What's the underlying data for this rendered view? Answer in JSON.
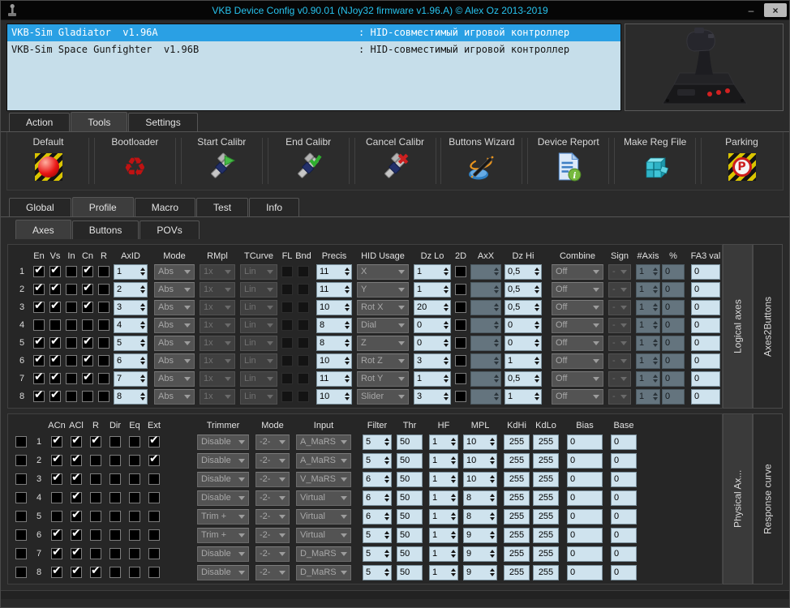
{
  "window": {
    "title": "VKB Device Config v0.90.01 (NJoy32 firmware v1.96.A) © Alex Oz 2013-2019",
    "minimize_label": "–",
    "close_label": "×"
  },
  "device_list": [
    {
      "name": "VKB-Sim Gladiator  v1.96A",
      "desc": ": HID-совместимый игровой контроллер",
      "selected": true
    },
    {
      "name": "VKB-Sim Space Gunfighter  v1.96B",
      "desc": ": HID-совместимый игровой контроллер",
      "selected": false
    }
  ],
  "joystick_image": "gladiator-joystick-photo",
  "main_tabs": [
    {
      "label": "Action",
      "active": false
    },
    {
      "label": "Tools",
      "active": true
    },
    {
      "label": "Settings",
      "active": false
    }
  ],
  "toolbar": [
    {
      "label": "Default",
      "icon": "default-hazard-icon"
    },
    {
      "label": "Bootloader",
      "icon": "bootloader-recycle-icon"
    },
    {
      "label": "Start Calibr",
      "icon": "caliper-play-icon"
    },
    {
      "label": "End Calibr",
      "icon": "caliper-check-icon"
    },
    {
      "label": "Cancel Calibr",
      "icon": "caliper-cross-icon"
    },
    {
      "label": "Buttons Wizard",
      "icon": "magic-wand-icon"
    },
    {
      "label": "Device Report",
      "icon": "document-info-icon"
    },
    {
      "label": "Make Reg File",
      "icon": "registry-cubes-icon"
    },
    {
      "label": "Parking",
      "icon": "parking-hazard-icon"
    }
  ],
  "profile_tabs": [
    {
      "label": "Global",
      "active": false
    },
    {
      "label": "Profile",
      "active": true
    },
    {
      "label": "Macro",
      "active": false
    },
    {
      "label": "Test",
      "active": false
    },
    {
      "label": "Info",
      "active": false
    }
  ],
  "axes_tabs": [
    {
      "label": "Axes",
      "active": true
    },
    {
      "label": "Buttons",
      "active": false
    },
    {
      "label": "POVs",
      "active": false
    }
  ],
  "logical_axes": {
    "side_tabs": [
      {
        "label": "Logical axes",
        "active": true
      },
      {
        "label": "Axes2Buttons",
        "active": false
      }
    ],
    "columns": [
      {
        "key": "num",
        "label": ""
      },
      {
        "key": "en",
        "label": "En"
      },
      {
        "key": "vs",
        "label": "Vs"
      },
      {
        "key": "in",
        "label": "In"
      },
      {
        "key": "cn",
        "label": "Cn"
      },
      {
        "key": "r",
        "label": "R"
      },
      {
        "key": "axid",
        "label": "AxID"
      },
      {
        "key": "mode",
        "label": "Mode"
      },
      {
        "key": "rmpl",
        "label": "RMpl"
      },
      {
        "key": "tcurve",
        "label": "TCurve"
      },
      {
        "key": "fl",
        "label": "FL"
      },
      {
        "key": "bnd",
        "label": "Bnd"
      },
      {
        "key": "precis",
        "label": "Precis"
      },
      {
        "key": "hid",
        "label": "HID Usage"
      },
      {
        "key": "dzlo",
        "label": "Dz Lo"
      },
      {
        "key": "d2",
        "label": "2D"
      },
      {
        "key": "axx",
        "label": "AxX"
      },
      {
        "key": "dzhi",
        "label": "Dz Hi"
      },
      {
        "key": "combine",
        "label": "Combine"
      },
      {
        "key": "sign",
        "label": "Sign"
      },
      {
        "key": "naxis",
        "label": "#Axis"
      },
      {
        "key": "pct",
        "label": "%"
      },
      {
        "key": "fa3",
        "label": "FA3 val"
      }
    ],
    "rows": [
      {
        "num": "1",
        "en": true,
        "vs": true,
        "in": false,
        "cn": true,
        "r": false,
        "axid": "1",
        "mode": "Abs",
        "rmpl": "1x",
        "tcurve": "Lin",
        "fl": false,
        "bnd": false,
        "precis": "11",
        "hid": "X",
        "dzlo": "1",
        "d2": false,
        "axx": "",
        "dzhi": "0,5",
        "combine": "Off",
        "sign": "-",
        "naxis": "1",
        "pct": "0",
        "fa3": "0"
      },
      {
        "num": "2",
        "en": true,
        "vs": true,
        "in": false,
        "cn": true,
        "r": false,
        "axid": "2",
        "mode": "Abs",
        "rmpl": "1x",
        "tcurve": "Lin",
        "fl": false,
        "bnd": false,
        "precis": "11",
        "hid": "Y",
        "dzlo": "1",
        "d2": false,
        "axx": "",
        "dzhi": "0,5",
        "combine": "Off",
        "sign": "-",
        "naxis": "1",
        "pct": "0",
        "fa3": "0"
      },
      {
        "num": "3",
        "en": true,
        "vs": true,
        "in": false,
        "cn": true,
        "r": false,
        "axid": "3",
        "mode": "Abs",
        "rmpl": "1x",
        "tcurve": "Lin",
        "fl": false,
        "bnd": false,
        "precis": "10",
        "hid": "Rot X",
        "dzlo": "20",
        "d2": false,
        "axx": "",
        "dzhi": "0,5",
        "combine": "Off",
        "sign": "-",
        "naxis": "1",
        "pct": "0",
        "fa3": "0"
      },
      {
        "num": "4",
        "en": false,
        "vs": false,
        "in": false,
        "cn": false,
        "r": false,
        "axid": "4",
        "mode": "Abs",
        "rmpl": "1x",
        "tcurve": "Lin",
        "fl": false,
        "bnd": false,
        "precis": "8",
        "hid": "Dial",
        "dzlo": "0",
        "d2": false,
        "axx": "",
        "dzhi": "0",
        "combine": "Off",
        "sign": "-",
        "naxis": "1",
        "pct": "0",
        "fa3": "0"
      },
      {
        "num": "5",
        "en": true,
        "vs": true,
        "in": false,
        "cn": true,
        "r": false,
        "axid": "5",
        "mode": "Abs",
        "rmpl": "1x",
        "tcurve": "Lin",
        "fl": false,
        "bnd": false,
        "precis": "8",
        "hid": "Z",
        "dzlo": "0",
        "d2": false,
        "axx": "",
        "dzhi": "0",
        "combine": "Off",
        "sign": "-",
        "naxis": "1",
        "pct": "0",
        "fa3": "0"
      },
      {
        "num": "6",
        "en": true,
        "vs": true,
        "in": false,
        "cn": true,
        "r": false,
        "axid": "6",
        "mode": "Abs",
        "rmpl": "1x",
        "tcurve": "Lin",
        "fl": false,
        "bnd": false,
        "precis": "10",
        "hid": "Rot Z",
        "dzlo": "3",
        "d2": false,
        "axx": "",
        "dzhi": "1",
        "combine": "Off",
        "sign": "-",
        "naxis": "1",
        "pct": "0",
        "fa3": "0"
      },
      {
        "num": "7",
        "en": true,
        "vs": true,
        "in": false,
        "cn": true,
        "r": false,
        "axid": "7",
        "mode": "Abs",
        "rmpl": "1x",
        "tcurve": "Lin",
        "fl": false,
        "bnd": false,
        "precis": "11",
        "hid": "Rot Y",
        "dzlo": "1",
        "d2": false,
        "axx": "",
        "dzhi": "0,5",
        "combine": "Off",
        "sign": "-",
        "naxis": "1",
        "pct": "0",
        "fa3": "0"
      },
      {
        "num": "8",
        "en": true,
        "vs": true,
        "in": false,
        "cn": false,
        "r": false,
        "axid": "8",
        "mode": "Abs",
        "rmpl": "1x",
        "tcurve": "Lin",
        "fl": false,
        "bnd": false,
        "precis": "10",
        "hid": "Slider",
        "dzlo": "3",
        "d2": false,
        "axx": "",
        "dzhi": "1",
        "combine": "Off",
        "sign": "-",
        "naxis": "1",
        "pct": "0",
        "fa3": "0"
      }
    ]
  },
  "physical_axes": {
    "side_tabs": [
      {
        "label": "Physical Ax...",
        "active": true
      },
      {
        "label": "Response curve",
        "active": false
      }
    ],
    "columns": [
      {
        "key": "sel",
        "label": ""
      },
      {
        "key": "num",
        "label": ""
      },
      {
        "key": "acn",
        "label": "ACn"
      },
      {
        "key": "acl",
        "label": "ACl"
      },
      {
        "key": "r",
        "label": "R"
      },
      {
        "key": "dir",
        "label": "Dir"
      },
      {
        "key": "eq",
        "label": "Eq"
      },
      {
        "key": "ext",
        "label": "Ext"
      },
      {
        "key": "trimmer",
        "label": "Trimmer"
      },
      {
        "key": "mode",
        "label": "Mode"
      },
      {
        "key": "input",
        "label": "Input"
      },
      {
        "key": "filter",
        "label": "Filter"
      },
      {
        "key": "thr",
        "label": "Thr"
      },
      {
        "key": "hf",
        "label": "HF"
      },
      {
        "key": "mpl",
        "label": "MPL"
      },
      {
        "key": "kdhi",
        "label": "KdHi"
      },
      {
        "key": "kdlo",
        "label": "KdLo"
      },
      {
        "key": "bias",
        "label": "Bias"
      },
      {
        "key": "base",
        "label": "Base"
      }
    ],
    "rows": [
      {
        "sel": false,
        "num": "1",
        "acn": true,
        "acl": true,
        "r": true,
        "dir": false,
        "eq": false,
        "ext": true,
        "trimmer": "Disable",
        "mode": "-2-",
        "input": "A_MaRS",
        "filter": "5",
        "thr": "50",
        "hf": "1",
        "mpl": "10",
        "kdhi": "255",
        "kdlo": "255",
        "bias": "0",
        "base": "0"
      },
      {
        "sel": false,
        "num": "2",
        "acn": true,
        "acl": true,
        "r": false,
        "dir": false,
        "eq": false,
        "ext": true,
        "trimmer": "Disable",
        "mode": "-2-",
        "input": "A_MaRS",
        "filter": "5",
        "thr": "50",
        "hf": "1",
        "mpl": "10",
        "kdhi": "255",
        "kdlo": "255",
        "bias": "0",
        "base": "0"
      },
      {
        "sel": false,
        "num": "3",
        "acn": true,
        "acl": true,
        "r": false,
        "dir": false,
        "eq": false,
        "ext": false,
        "trimmer": "Disable",
        "mode": "-2-",
        "input": "V_MaRS",
        "filter": "6",
        "thr": "50",
        "hf": "1",
        "mpl": "10",
        "kdhi": "255",
        "kdlo": "255",
        "bias": "0",
        "base": "0"
      },
      {
        "sel": false,
        "num": "4",
        "acn": false,
        "acl": true,
        "r": false,
        "dir": false,
        "eq": false,
        "ext": false,
        "trimmer": "Disable",
        "mode": "-2-",
        "input": "Virtual",
        "filter": "6",
        "thr": "50",
        "hf": "1",
        "mpl": "8",
        "kdhi": "255",
        "kdlo": "255",
        "bias": "0",
        "base": "0"
      },
      {
        "sel": false,
        "num": "5",
        "acn": false,
        "acl": true,
        "r": false,
        "dir": false,
        "eq": false,
        "ext": false,
        "trimmer": "Trim +",
        "mode": "-2-",
        "input": "Virtual",
        "filter": "6",
        "thr": "50",
        "hf": "1",
        "mpl": "8",
        "kdhi": "255",
        "kdlo": "255",
        "bias": "0",
        "base": "0"
      },
      {
        "sel": false,
        "num": "6",
        "acn": true,
        "acl": true,
        "r": false,
        "dir": false,
        "eq": false,
        "ext": false,
        "trimmer": "Trim +",
        "mode": "-2-",
        "input": "Virtual",
        "filter": "5",
        "thr": "50",
        "hf": "1",
        "mpl": "9",
        "kdhi": "255",
        "kdlo": "255",
        "bias": "0",
        "base": "0"
      },
      {
        "sel": false,
        "num": "7",
        "acn": true,
        "acl": true,
        "r": false,
        "dir": false,
        "eq": false,
        "ext": false,
        "trimmer": "Disable",
        "mode": "-2-",
        "input": "D_MaRS",
        "filter": "5",
        "thr": "50",
        "hf": "1",
        "mpl": "9",
        "kdhi": "255",
        "kdlo": "255",
        "bias": "0",
        "base": "0"
      },
      {
        "sel": false,
        "num": "8",
        "acn": true,
        "acl": true,
        "r": true,
        "dir": false,
        "eq": false,
        "ext": false,
        "trimmer": "Disable",
        "mode": "-2-",
        "input": "D_MaRS",
        "filter": "5",
        "thr": "50",
        "hf": "1",
        "mpl": "9",
        "kdhi": "255",
        "kdlo": "255",
        "bias": "0",
        "base": "0"
      }
    ]
  }
}
